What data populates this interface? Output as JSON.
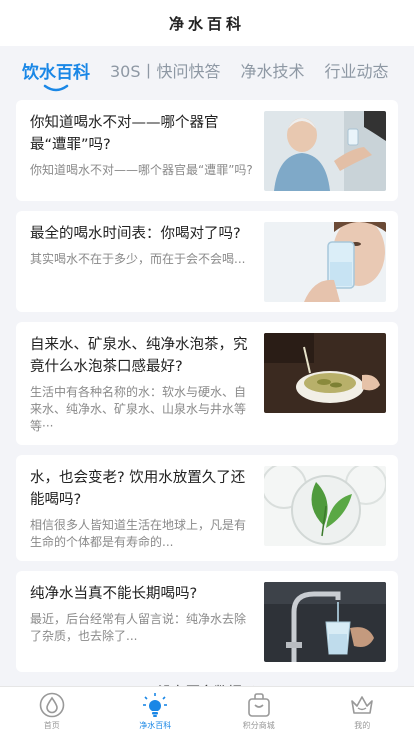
{
  "header": {
    "title": "净水百科"
  },
  "tabs": [
    {
      "label": "饮水百科",
      "active": true
    },
    {
      "label": "30S丨快问快答",
      "active": false
    },
    {
      "label": "净水技术",
      "active": false
    },
    {
      "label": "行业动态",
      "active": false
    }
  ],
  "articles": [
    {
      "title": "你知道喝水不对——哪个器官最“遭罪”吗?",
      "summary": "你知道喝水不对——哪个器官最“遭罪”吗?",
      "thumb": "elderly-man-drinking-water"
    },
    {
      "title": "最全的喝水时间表：你喝对了吗?",
      "summary": "其实喝水不在于多少，而在于会不会喝...",
      "thumb": "woman-drinking-glass"
    },
    {
      "title": "自来水、矿泉水、纯净水泡茶，究竟什么水泡茶口感最好?",
      "summary": "生活中有各种名称的水：软水与硬水、自来水、纯净水、矿泉水、山泉水与井水等等···",
      "thumb": "tea-cup"
    },
    {
      "title": "水，也会变老? 饮用水放置久了还能喝吗?",
      "summary": "相信很多人皆知道生活在地球上，凡是有生命的个体都是有寿命的...",
      "thumb": "leaf-petri-dish"
    },
    {
      "title": "纯净水当真不能长期喝吗?",
      "summary": "最近，后台经常有人留言说：纯净水去除了杂质，也去除了...",
      "thumb": "faucet-glass"
    }
  ],
  "footer": {
    "no_more": "没有更多数据了"
  },
  "bottom_nav": [
    {
      "label": "首页",
      "icon": "water-drop-icon",
      "active": false
    },
    {
      "label": "净水百科",
      "icon": "lightbulb-icon",
      "active": true
    },
    {
      "label": "积分商城",
      "icon": "shopping-bag-icon",
      "active": false
    },
    {
      "label": "我的",
      "icon": "crown-icon",
      "active": false
    }
  ],
  "colors": {
    "accent": "#1a87e6",
    "inactive": "#8e98a4",
    "background": "#f3f4f8"
  }
}
